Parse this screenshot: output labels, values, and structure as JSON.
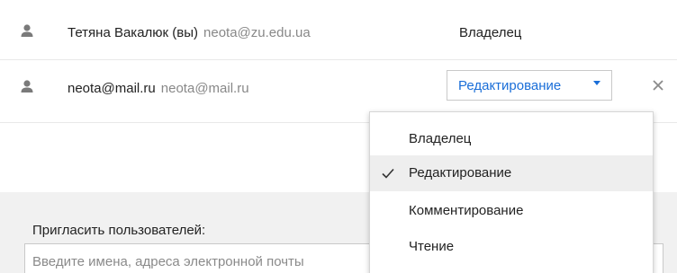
{
  "owner_row": {
    "name": "Тетяна Вакалюк (вы)",
    "email": "neota@zu.edu.ua",
    "role": "Владелец"
  },
  "editor_row": {
    "name": "neota@mail.ru",
    "email": "neota@mail.ru",
    "selected_role": "Редактирование"
  },
  "role_menu": {
    "items": [
      {
        "label": "Владелец",
        "selected": false
      },
      {
        "label": "Редактирование",
        "selected": true
      },
      {
        "label": "Комментирование",
        "selected": false
      },
      {
        "label": "Чтение",
        "selected": false
      }
    ]
  },
  "invite": {
    "label": "Пригласить пользователей:",
    "placeholder": "Введите имена, адреса электронной почты"
  },
  "colors": {
    "accent": "#1a6ed8",
    "muted_text": "#888888",
    "icon_grey": "#7a7a7a"
  },
  "icons": {
    "person": "person-icon",
    "remove": "close-icon",
    "dropdown": "caret-down-icon",
    "check": "checkmark-icon"
  }
}
